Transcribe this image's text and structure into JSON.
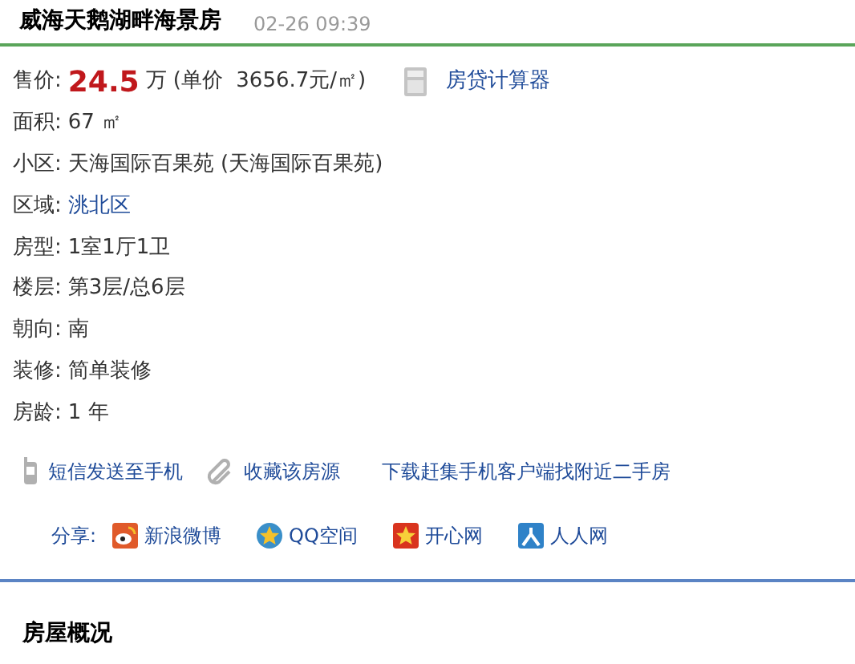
{
  "header": {
    "title": "威海天鹅湖畔海景房",
    "time": "02-26 09:39"
  },
  "price": {
    "label": "售价:",
    "amount": "24.5",
    "unit": "万",
    "unit_price": "(单价  3656.7元/㎡)",
    "calculator": "房贷计算器"
  },
  "fields": [
    {
      "label": "面积:",
      "value": "67 ㎡",
      "kind": "text"
    },
    {
      "label": "小区:",
      "value": "天海国际百果苑 (天海国际百果苑)",
      "kind": "text"
    },
    {
      "label": "区域:",
      "value": "洮北区",
      "kind": "link"
    },
    {
      "label": "房型:",
      "value": "1室1厅1卫",
      "kind": "text"
    },
    {
      "label": "楼层:",
      "value": "第3层/总6层",
      "kind": "text"
    },
    {
      "label": "朝向:",
      "value": "南",
      "kind": "text"
    },
    {
      "label": "装修:",
      "value": "简单装修",
      "kind": "text"
    },
    {
      "label": "房龄:",
      "value": "1 年",
      "kind": "text"
    }
  ],
  "actions": [
    {
      "label": "短信发送至手机",
      "kind": "phone"
    },
    {
      "label": "收藏该房源",
      "kind": "clip"
    },
    {
      "label": "下载赶集手机客户端找附近二手房",
      "kind": "none"
    }
  ],
  "share": {
    "label": "分享:",
    "items": [
      {
        "label": "新浪微博",
        "kind": "weibo"
      },
      {
        "label": "QQ空间",
        "kind": "qzone"
      },
      {
        "label": "开心网",
        "kind": "kaixin"
      },
      {
        "label": "人人网",
        "kind": "renren"
      }
    ]
  },
  "section_title": "房屋概况"
}
